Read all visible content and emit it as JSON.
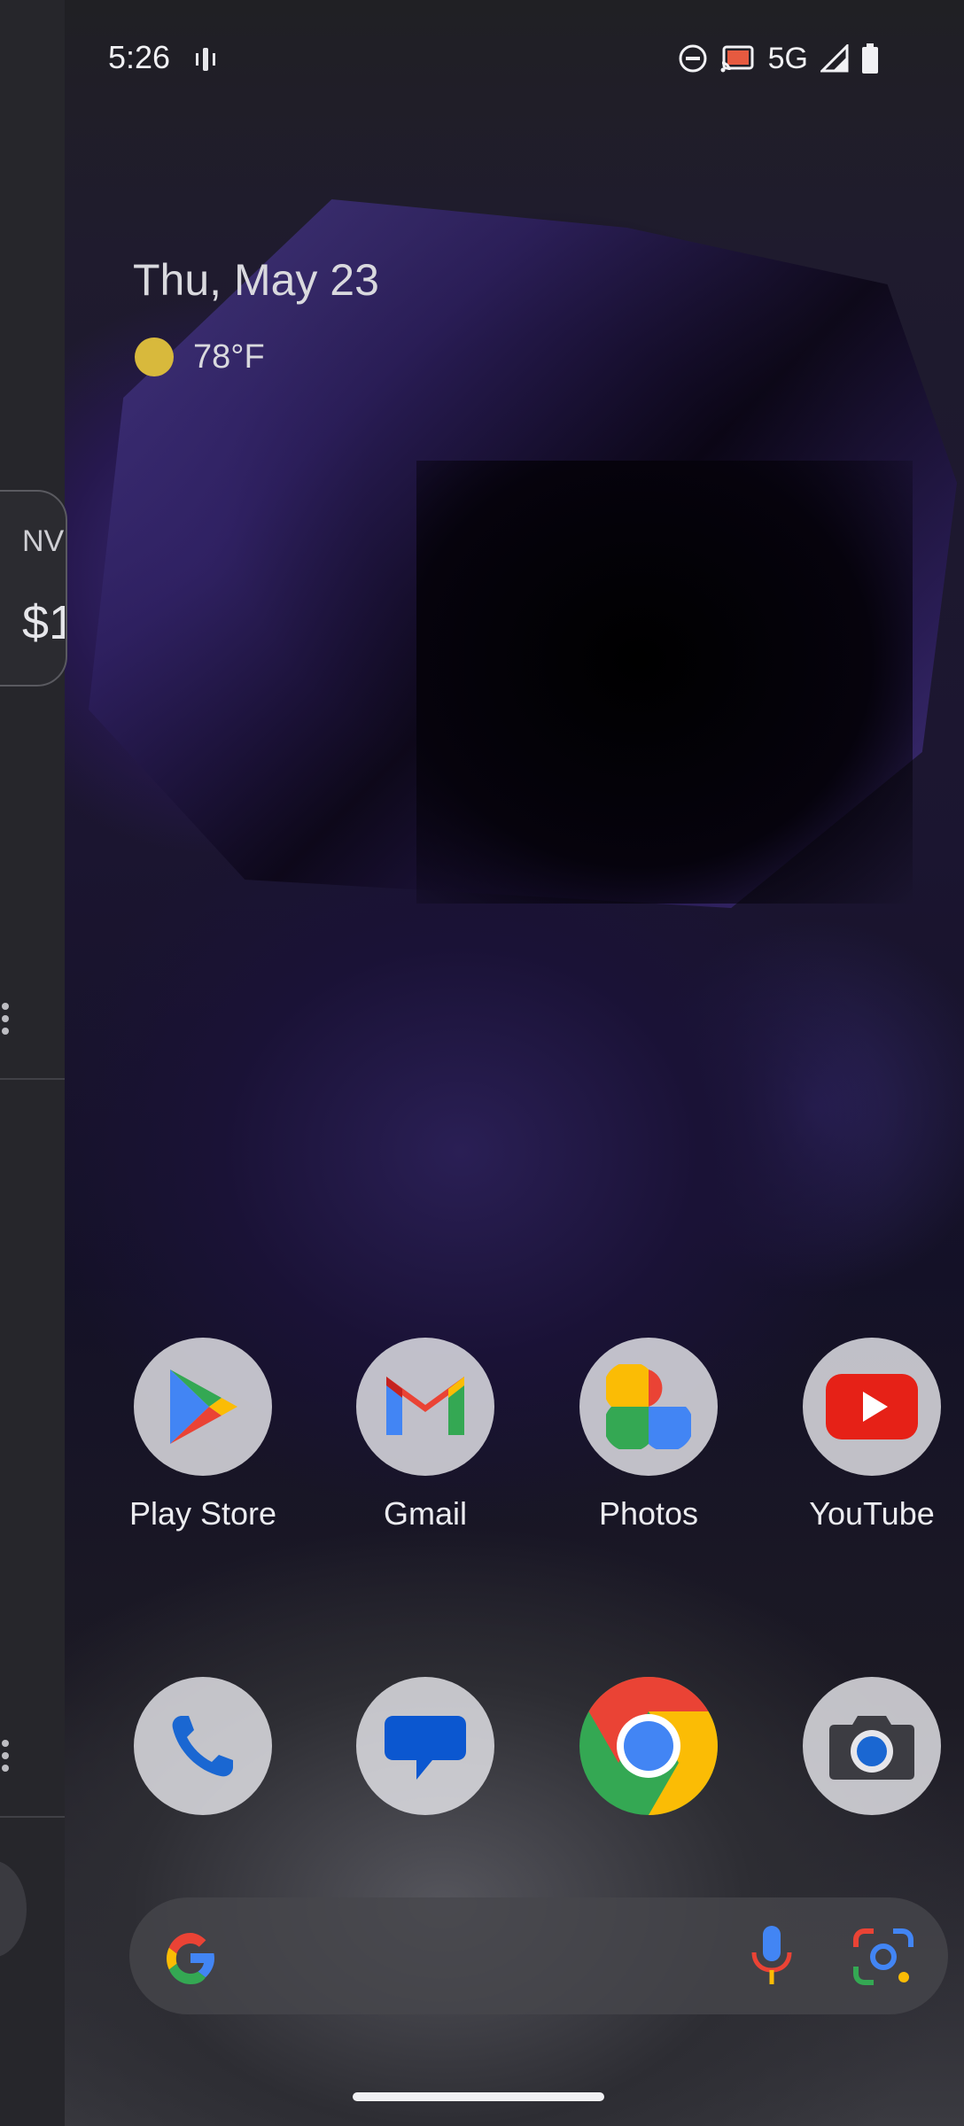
{
  "status_bar": {
    "time": "5:26",
    "network": "5G",
    "icons": [
      "vibrate-icon",
      "do-not-disturb-icon",
      "cast-icon",
      "signal-icon",
      "battery-icon"
    ]
  },
  "widget": {
    "date": "Thu, May 23",
    "temperature": "78°F",
    "weather_icon": "sun-icon"
  },
  "left_panel": {
    "stock_ticker": "NV",
    "stock_price": "$1"
  },
  "apps": {
    "row1": [
      {
        "label": "Play Store",
        "icon": "play-store-icon"
      },
      {
        "label": "Gmail",
        "icon": "gmail-icon"
      },
      {
        "label": "Photos",
        "icon": "photos-icon"
      },
      {
        "label": "YouTube",
        "icon": "youtube-icon"
      }
    ],
    "dock": [
      {
        "icon": "phone-icon"
      },
      {
        "icon": "messages-icon"
      },
      {
        "icon": "chrome-icon"
      },
      {
        "icon": "camera-icon"
      }
    ]
  },
  "search": {
    "icons": [
      "google-g-icon",
      "microphone-icon",
      "lens-icon"
    ]
  },
  "colors": {
    "google_blue": "#4285F4",
    "google_red": "#EA4335",
    "google_yellow": "#FBBC05",
    "google_green": "#34A853",
    "youtube_red": "#E62117"
  }
}
